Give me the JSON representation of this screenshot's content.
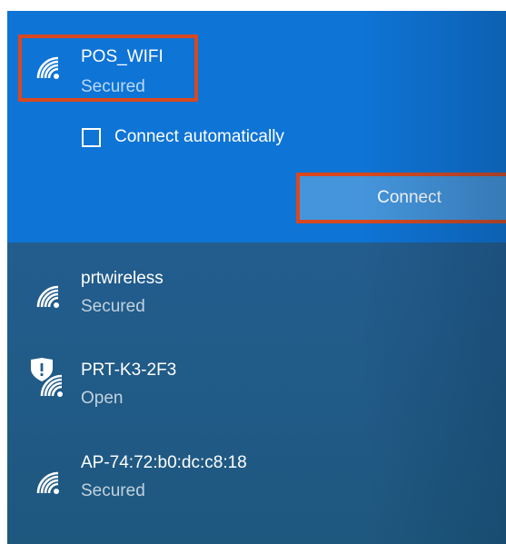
{
  "selected_network": {
    "name": "POS_WIFI",
    "status": "Secured",
    "icon": "wifi-signal-icon",
    "connect_automatically_label": "Connect automatically",
    "connect_automatically_checked": false,
    "connect_button_label": "Connect",
    "highlight_color": "#d9481e"
  },
  "networks": [
    {
      "name": "prtwireless",
      "status": "Secured",
      "icon": "wifi-signal-icon"
    },
    {
      "name": "PRT-K3-2F3",
      "status": "Open",
      "icon": "wifi-open-warning-icon"
    },
    {
      "name": "AP-74:72:b0:dc:c8:18",
      "status": "Secured",
      "icon": "wifi-signal-icon"
    }
  ],
  "colors": {
    "selected_bg": "#0e74d6",
    "list_bg": "#235d8e",
    "button_bg": "#4595dc",
    "text": "#ffffff"
  }
}
